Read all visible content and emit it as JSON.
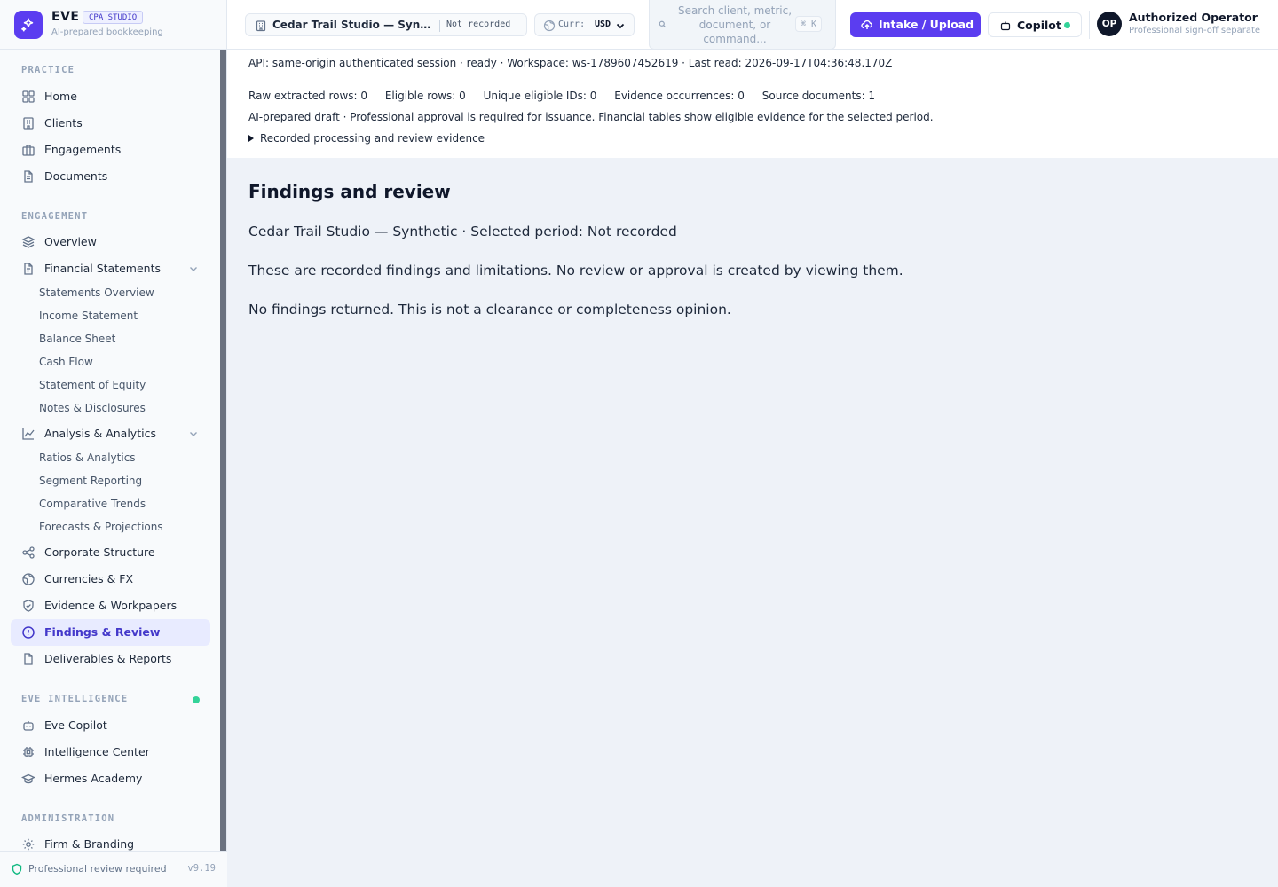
{
  "brand": {
    "name": "EVE",
    "badge": "CPA STUDIO",
    "subtitle": "AI-prepared bookkeeping",
    "accent": "#5b3df0"
  },
  "sidebar": {
    "sections": {
      "practice": "PRACTICE",
      "engagement": "ENGAGEMENT",
      "intelligence": "EVE INTELLIGENCE",
      "administration": "ADMINISTRATION"
    },
    "practice_items": [
      {
        "label": "Home",
        "icon": "grid-icon"
      },
      {
        "label": "Clients",
        "icon": "building-icon"
      },
      {
        "label": "Engagements",
        "icon": "briefcase-icon"
      },
      {
        "label": "Documents",
        "icon": "document-icon"
      }
    ],
    "engagement_items": {
      "overview": "Overview",
      "financial_statements": "Financial Statements",
      "fs_sub": [
        "Statements Overview",
        "Income Statement",
        "Balance Sheet",
        "Cash Flow",
        "Statement of Equity",
        "Notes & Disclosures"
      ],
      "analysis": "Analysis & Analytics",
      "analysis_sub": [
        "Ratios & Analytics",
        "Segment Reporting",
        "Comparative Trends",
        "Forecasts & Projections"
      ],
      "corporate_structure": "Corporate Structure",
      "currencies": "Currencies & FX",
      "evidence": "Evidence & Workpapers",
      "findings": "Findings & Review",
      "deliverables": "Deliverables & Reports"
    },
    "intelligence_items": [
      "Eve Copilot",
      "Intelligence Center",
      "Hermes Academy"
    ],
    "admin_items": [
      "Firm & Branding"
    ],
    "footer": {
      "label": "Professional review required",
      "version": "v9.19"
    }
  },
  "topbar": {
    "client_name": "Cedar Trail Studio — Syn…",
    "period": "Not recorded",
    "currency_label": "Curr:",
    "currency_value": "USD",
    "search_placeholder": "Search client, metric, document, or command...",
    "search_shortcut": "⌘ K",
    "upload_label": "Intake / Upload",
    "copilot_label": "Copilot",
    "user_initials": "OP",
    "user_name": "Authorized Operator",
    "user_sub": "Professional sign-off separate"
  },
  "status": {
    "api_line": "API: same-origin authenticated session · ready · Workspace: ws-1789607452619 · Last read: 2026-09-17T04:36:48.170Z",
    "counts": {
      "raw": "Raw extracted rows: 0",
      "eligible": "Eligible rows: 0",
      "unique": "Unique eligible IDs: 0",
      "occurrences": "Evidence occurrences: 0",
      "sources": "Source documents: 1"
    },
    "draft_line": "AI-prepared draft · Professional approval is required for issuance. Financial tables show eligible evidence for the selected period.",
    "evidence_toggle": "Recorded processing and review evidence"
  },
  "main": {
    "title": "Findings and review",
    "context": "Cedar Trail Studio — Synthetic · Selected period: Not recorded",
    "description": "These are recorded findings and limitations. No review or approval is created by viewing them.",
    "empty_state": "No findings returned. This is not a clearance or completeness opinion."
  }
}
